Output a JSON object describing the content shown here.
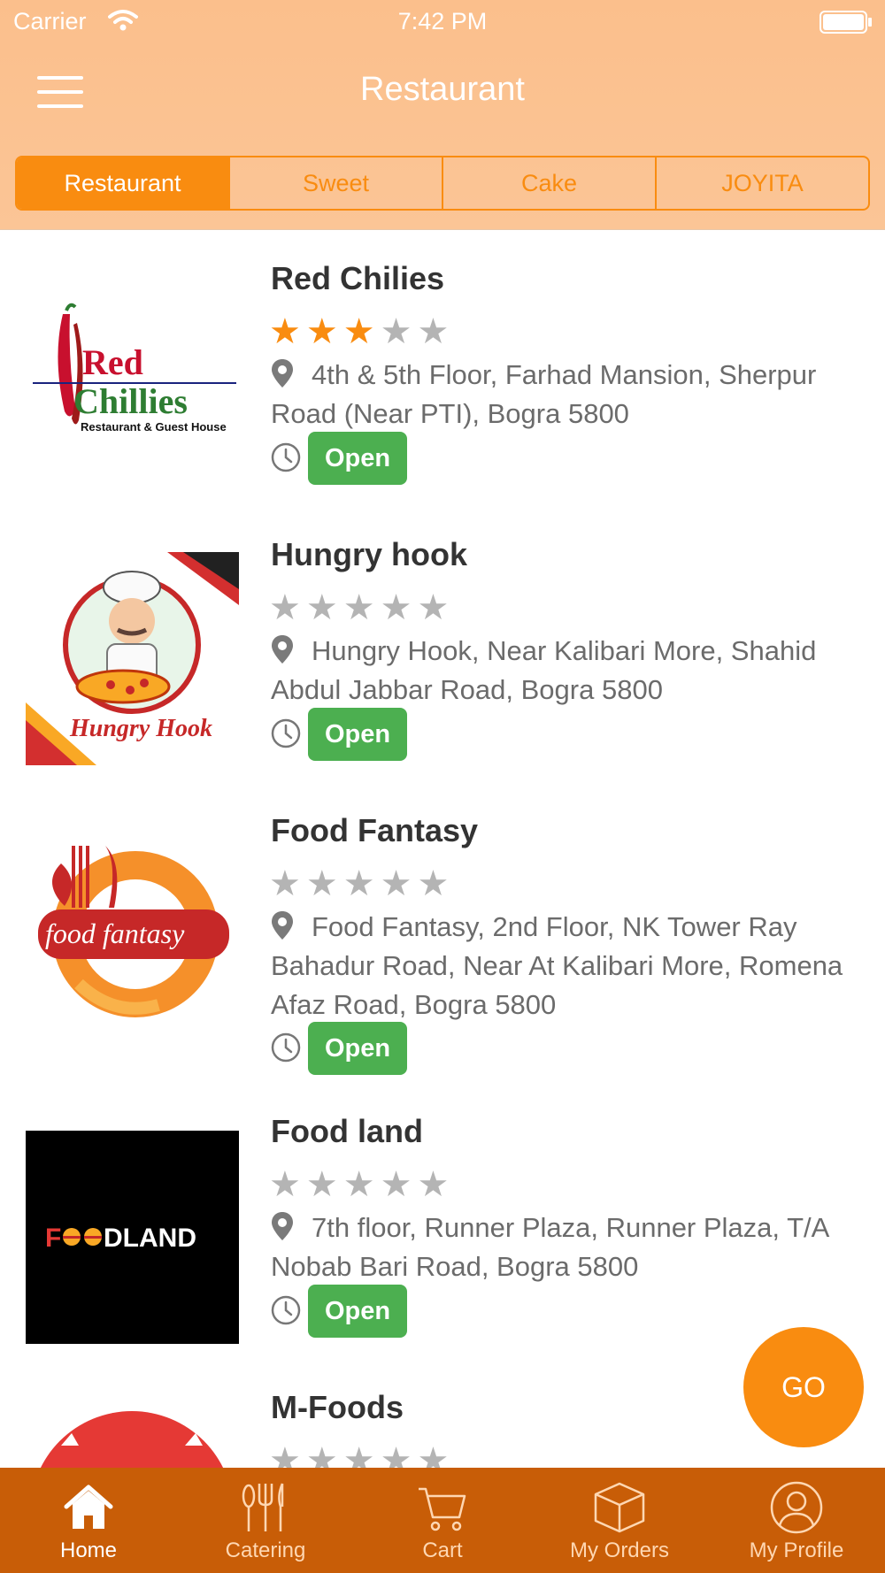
{
  "status_bar": {
    "carrier": "Carrier",
    "time": "7:42 PM"
  },
  "nav": {
    "title": "Restaurant"
  },
  "segments": [
    {
      "label": "Restaurant",
      "selected": true
    },
    {
      "label": "Sweet",
      "selected": false
    },
    {
      "label": "Cake",
      "selected": false
    },
    {
      "label": "JOYITA",
      "selected": false
    }
  ],
  "restaurants": [
    {
      "name": "Red Chilies",
      "rating": 3,
      "address": "4th & 5th Floor, Farhad Mansion, Sherpur Road (Near PTI), Bogra 5800",
      "status": "Open",
      "logo": {
        "line1": "Red",
        "line2": "Chillies",
        "tagline": "Restaurant & Guest House"
      }
    },
    {
      "name": "Hungry hook",
      "rating": 0,
      "address": "Hungry Hook, Near Kalibari More, Shahid Abdul Jabbar Road, Bogra 5800",
      "status": "Open",
      "logo": {
        "text": "Hungry Hook"
      }
    },
    {
      "name": "Food Fantasy",
      "rating": 0,
      "address": "Food Fantasy, 2nd Floor, NK Tower Ray Bahadur Road, Near At Kalibari More, Romena Afaz Road, Bogra 5800",
      "status": "Open",
      "logo": {
        "text": "food fantasy"
      }
    },
    {
      "name": "Food land",
      "rating": 0,
      "address": "7th floor, Runner Plaza, Runner Plaza, T/A Nobab Bari Road, Bogra 5800",
      "status": "Open",
      "logo": {
        "text_start": "F",
        "text_end": "DLAND"
      }
    },
    {
      "name": "M-Foods",
      "rating": 0
    }
  ],
  "go_button": {
    "label": "GO"
  },
  "tabs": [
    {
      "label": "Home",
      "icon": "home-icon",
      "active": true
    },
    {
      "label": "Catering",
      "icon": "cutlery-icon",
      "active": false
    },
    {
      "label": "Cart",
      "icon": "cart-icon",
      "active": false
    },
    {
      "label": "My Orders",
      "icon": "box-icon",
      "active": false
    },
    {
      "label": "My Profile",
      "icon": "profile-icon",
      "active": false
    }
  ],
  "colors": {
    "accent": "#f98c10",
    "header_bg": "#fbc08f",
    "tabbar_bg": "#c85d07",
    "open_badge": "#4caf50",
    "star_off": "#b4b4b4"
  }
}
